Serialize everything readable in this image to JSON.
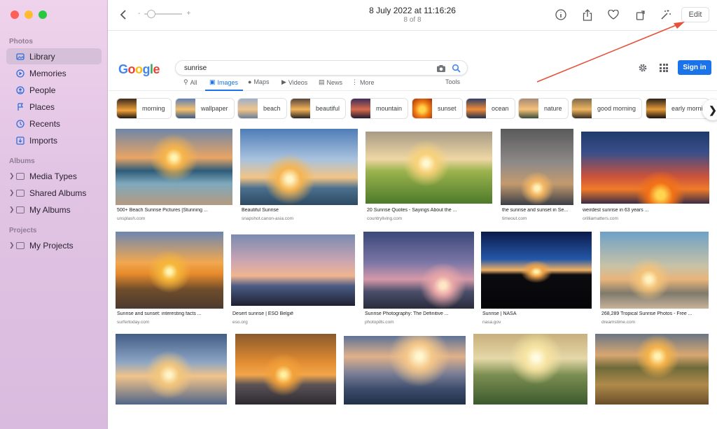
{
  "toolbar": {
    "title": "8 July 2022 at 11:16:26",
    "subtitle": "8 of 8",
    "edit_label": "Edit",
    "zoom_minus": "-",
    "zoom_plus": "+"
  },
  "sidebar": {
    "photos_header": "Photos",
    "photos_items": [
      {
        "label": "Library",
        "icon": "library-icon"
      },
      {
        "label": "Memories",
        "icon": "memories-icon"
      },
      {
        "label": "People",
        "icon": "people-icon"
      },
      {
        "label": "Places",
        "icon": "places-icon"
      },
      {
        "label": "Recents",
        "icon": "recents-icon"
      },
      {
        "label": "Imports",
        "icon": "imports-icon"
      }
    ],
    "albums_header": "Albums",
    "album_items": [
      "Media Types",
      "Shared Albums",
      "My Albums"
    ],
    "projects_header": "Projects",
    "project_items": [
      "My Projects"
    ]
  },
  "google": {
    "logo": "Google",
    "query": "sunrise",
    "signin": "Sign in",
    "tabs": [
      "All",
      "Images",
      "Maps",
      "Videos",
      "News",
      "More"
    ],
    "tools": "Tools",
    "chips": [
      "morning",
      "wallpaper",
      "beach",
      "beautiful",
      "mountain",
      "sunset",
      "ocean",
      "nature",
      "good morning",
      "early morni"
    ],
    "results": [
      {
        "caption": "500+ Beach Sunrise Pictures [Stunning ...",
        "domain": "unsplash.com"
      },
      {
        "caption": "Beautiful Sunrise",
        "domain": "snapshot.canon-asia.com"
      },
      {
        "caption": "20 Sunrise Quotes - Sayings About the ...",
        "domain": "countryliving.com"
      },
      {
        "caption": "the sunrise and sunset in Se...",
        "domain": "timeout.com"
      },
      {
        "caption": "weirdest sunrise in 63 years ...",
        "domain": "orilliamatters.com"
      },
      {
        "caption": "Sunrise and sunset: interesting facts ...",
        "domain": "surfertoday.com"
      },
      {
        "caption": "Desert sunrise | ESO België",
        "domain": "eso.org"
      },
      {
        "caption": "Sunrise Photography: The Definitive ...",
        "domain": "photopills.com"
      },
      {
        "caption": "Sunrise | NASA",
        "domain": "nasa.gov"
      },
      {
        "caption": "268,289 Tropical Sunrise Photos - Free ...",
        "domain": "dreamstime.com"
      },
      {
        "caption": "",
        "domain": ""
      },
      {
        "caption": "",
        "domain": ""
      },
      {
        "caption": "",
        "domain": ""
      },
      {
        "caption": "",
        "domain": ""
      },
      {
        "caption": "",
        "domain": ""
      }
    ]
  },
  "colors": {
    "accent": "#2f6ed9",
    "google_blue": "#1a73e8",
    "annotation_arrow": "#e4523b"
  }
}
